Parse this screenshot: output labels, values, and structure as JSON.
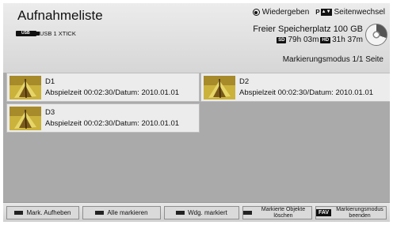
{
  "header": {
    "title": "Aufnahmeliste",
    "device": {
      "icon_text": "USB",
      "name": "USB 1 XTICK"
    },
    "hints": [
      {
        "key": "radio-dot",
        "label": "Wiedergeben"
      },
      {
        "key": "P",
        "key_sub": "page",
        "label": "Seitenwechsel"
      }
    ],
    "storage": {
      "free_label": "Freier Speicherplatz 100 GB",
      "sd_badge": "SD",
      "sd_time": "79h 03m",
      "hd_badge": "HD",
      "hd_time": "31h 37m"
    },
    "mode": "Markierungsmodus 1/1 Seite"
  },
  "items": [
    {
      "name": "D1",
      "meta": "Abspielzeit 00:02:30/Datum: 2010.01.01"
    },
    {
      "name": "D2",
      "meta": "Abspielzeit 00:02:30/Datum: 2010.01.01"
    },
    {
      "name": "D3",
      "meta": "Abspielzeit 00:02:30/Datum: 2010.01.01"
    }
  ],
  "footer": {
    "buttons": [
      {
        "key": "red",
        "label": "Mark. Aufheben"
      },
      {
        "key": "green",
        "label": "Alle markieren"
      },
      {
        "key": "yellow",
        "label": "Wdg. markiert"
      },
      {
        "key": "blue",
        "label": "Markierte Objekte löschen"
      },
      {
        "key": "FAV",
        "label": "Markierungsmodus beenden"
      }
    ]
  },
  "colors": {
    "background": "#aaaaaa",
    "header": "#e2e2e2",
    "item_background": "#ececec",
    "thumbnail": "#d9c24d"
  }
}
